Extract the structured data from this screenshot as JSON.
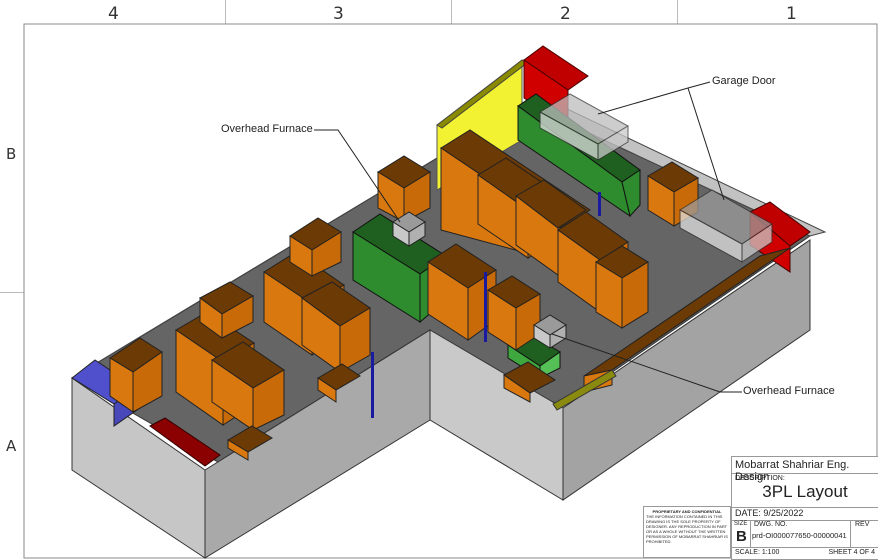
{
  "grid": {
    "columns": [
      "4",
      "3",
      "2",
      "1"
    ],
    "rows": [
      "B",
      "A"
    ]
  },
  "callouts": {
    "garage_door": "Garage Door",
    "overhead_furnace_top": "Overhead Furnace",
    "overhead_furnace_bottom": "Overhead Furnace"
  },
  "title_block": {
    "company": "Mobarrat Shahriar Eng. Design",
    "description_label": "DESCRIPTION:",
    "title": "3PL Layout",
    "date": "DATE: 9/25/2022",
    "size_label": "SIZE",
    "size": "B",
    "dwg_label": "DWG.  NO.",
    "dwg_no": "prd-OI000077650-00000041",
    "rev_label": "REV",
    "scale": "SCALE: 1:100",
    "sheet": "SHEET 4 OF 4"
  },
  "proprietary": {
    "heading": "PROPRIETARY AND CONFIDENTIAL",
    "body": "THE INFORMATION CONTAINED IN THIS DRAWING IS THE SOLE PROPERTY OF DESIGNER. ANY REPRODUCTION IN PART OR AS A WHOLE WITHOUT THE WRITTEN PERMISSION OF MOBARRAT SHAHRIAR IS PROHIBITED."
  },
  "colors": {
    "floor": "#656565",
    "wall": "#c2c2c2",
    "shelf_orange": "#d9780f",
    "shelf_top": "#6b3a05",
    "green_unit": "#2e8b2e",
    "yellow_door": "#eeee22",
    "red_unit": "#c00000",
    "blue_unit": "#5555cc"
  }
}
